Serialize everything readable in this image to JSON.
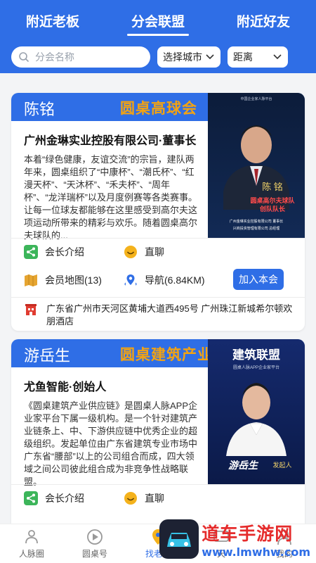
{
  "tabs": [
    {
      "label": "附近老板"
    },
    {
      "label": "分会联盟"
    },
    {
      "label": "附近好友"
    }
  ],
  "search": {
    "placeholder": "分会名称"
  },
  "filters": {
    "city_label": "选择城市",
    "distance_label": "距离"
  },
  "cards": [
    {
      "name": "陈铭",
      "tag": "圆桌高球会",
      "company": "广州金琳实业控股有限公司·董事长",
      "description": "本着“绿色健康，友谊交流”的宗旨，建队两年来，圆桌组织了“中康杯”、“潮氏杯”、“红漫天杯”、“天沐杯”、“禾夫杯”、“周年杯”、“龙洋瑞杯”以及月度例赛等各类赛事。让每一位球友都能够在这里感受到高尔夫这项运动所带来的精彩与欢乐。随着圆桌高尔夫球队的...",
      "photo_caption_top": "中国企业家人脉平台",
      "photo_name": "陈 铭",
      "photo_title_1": "圆桌高尔夫球队",
      "photo_title_2": "创队队长",
      "photo_sub_1": "广州金琳实业控股有限公司 董事长",
      "photo_sub_2": "兴商投资管理有限公司 总经理",
      "actions": {
        "intro": "会长介绍",
        "chat": "直聊",
        "map": "会员地图(13)",
        "nav": "导航(6.84KM)",
        "join": "加入本会"
      },
      "address": "广东省广州市天河区黄埔大道西495号 广州珠江新城希尔顿欢朋酒店"
    },
    {
      "name": "游岳生",
      "tag": "圆桌建筑产业",
      "company": "尤鱼智能·创始人",
      "description": "《圆桌建筑产业供应链》是圆桌人脉APP企业家平台下属一级机构。是一个针对建筑产业链条上、中、下游供应链中优秀企业的超级组织。发起单位由广东省建筑专业市场中广东省“腰部”以上的公司组合而成，四大领域之间公司彼此组合成为非竞争性战略联盟。",
      "photo_title": "建筑联盟",
      "photo_caption_top": "圆桌人脉APP企业家平台",
      "photo_name": "游岳生",
      "photo_role": "发起人",
      "actions": {
        "intro": "会长介绍",
        "chat": "直聊"
      }
    }
  ],
  "bottom_nav": [
    {
      "label": "人脉圈"
    },
    {
      "label": "圆桌号"
    },
    {
      "label": "找老板"
    },
    {
      "label": "天"
    },
    {
      "label": "我的"
    }
  ],
  "watermark": {
    "title": "道车手游网",
    "url": "www.lmwhw.com"
  },
  "colors": {
    "primary": "#2f6ee6",
    "accent": "#f2a313",
    "background": "#f3f4f6"
  }
}
